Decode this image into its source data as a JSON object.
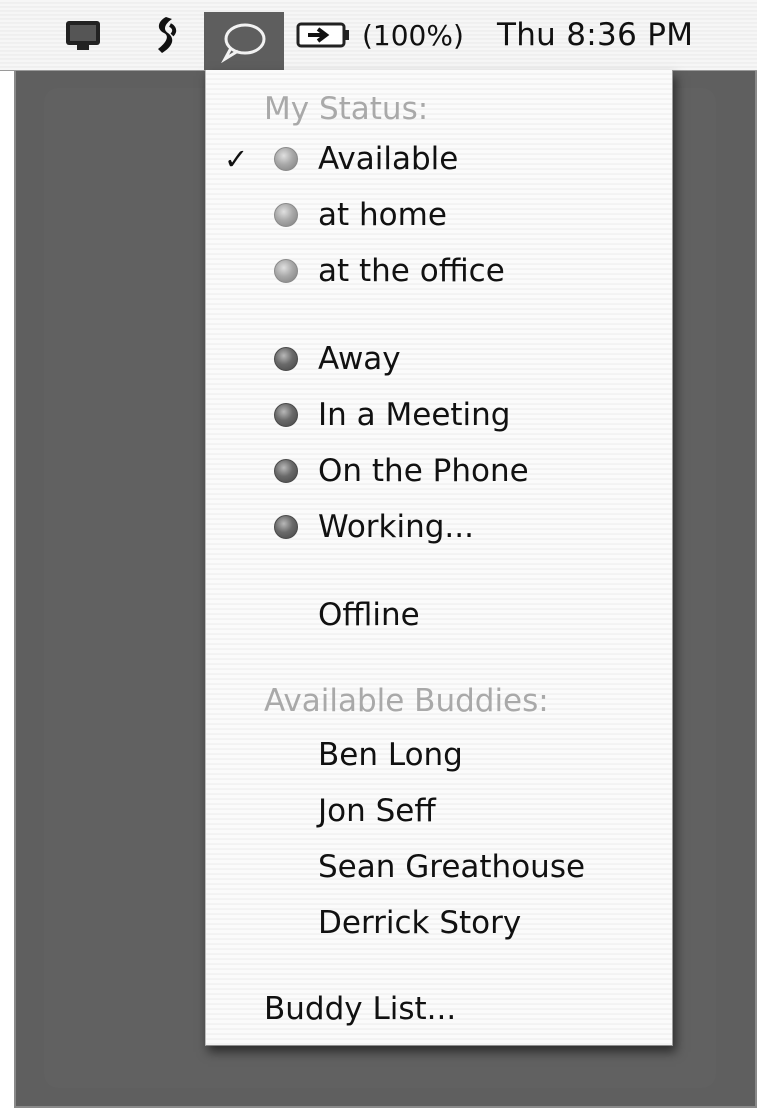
{
  "menubar": {
    "display_icon": "display-icon",
    "script_icon": "script-icon",
    "ichat_icon": "ichat-speech-bubble-icon",
    "battery_icon": "battery-plug-icon",
    "battery_text": "(100%)",
    "clock": "Thu 8:36 PM"
  },
  "menu": {
    "my_status_header": "My Status:",
    "status_items": [
      {
        "label": "Available",
        "checked": true,
        "dot": "available"
      },
      {
        "label": "at home",
        "checked": false,
        "dot": "available"
      },
      {
        "label": "at the office",
        "checked": false,
        "dot": "available"
      },
      {
        "label": "Away",
        "checked": false,
        "dot": "away"
      },
      {
        "label": "In a Meeting",
        "checked": false,
        "dot": "away"
      },
      {
        "label": "On the Phone",
        "checked": false,
        "dot": "away"
      },
      {
        "label": "Working...",
        "checked": false,
        "dot": "away"
      },
      {
        "label": "Offline",
        "checked": false,
        "dot": "none"
      }
    ],
    "checkmark": "✓",
    "buddies_header": "Available Buddies:",
    "buddies": [
      "Ben Long",
      "Jon Seff",
      "Sean Greathouse",
      "Derrick Story"
    ],
    "buddy_list_item": "Buddy List..."
  }
}
